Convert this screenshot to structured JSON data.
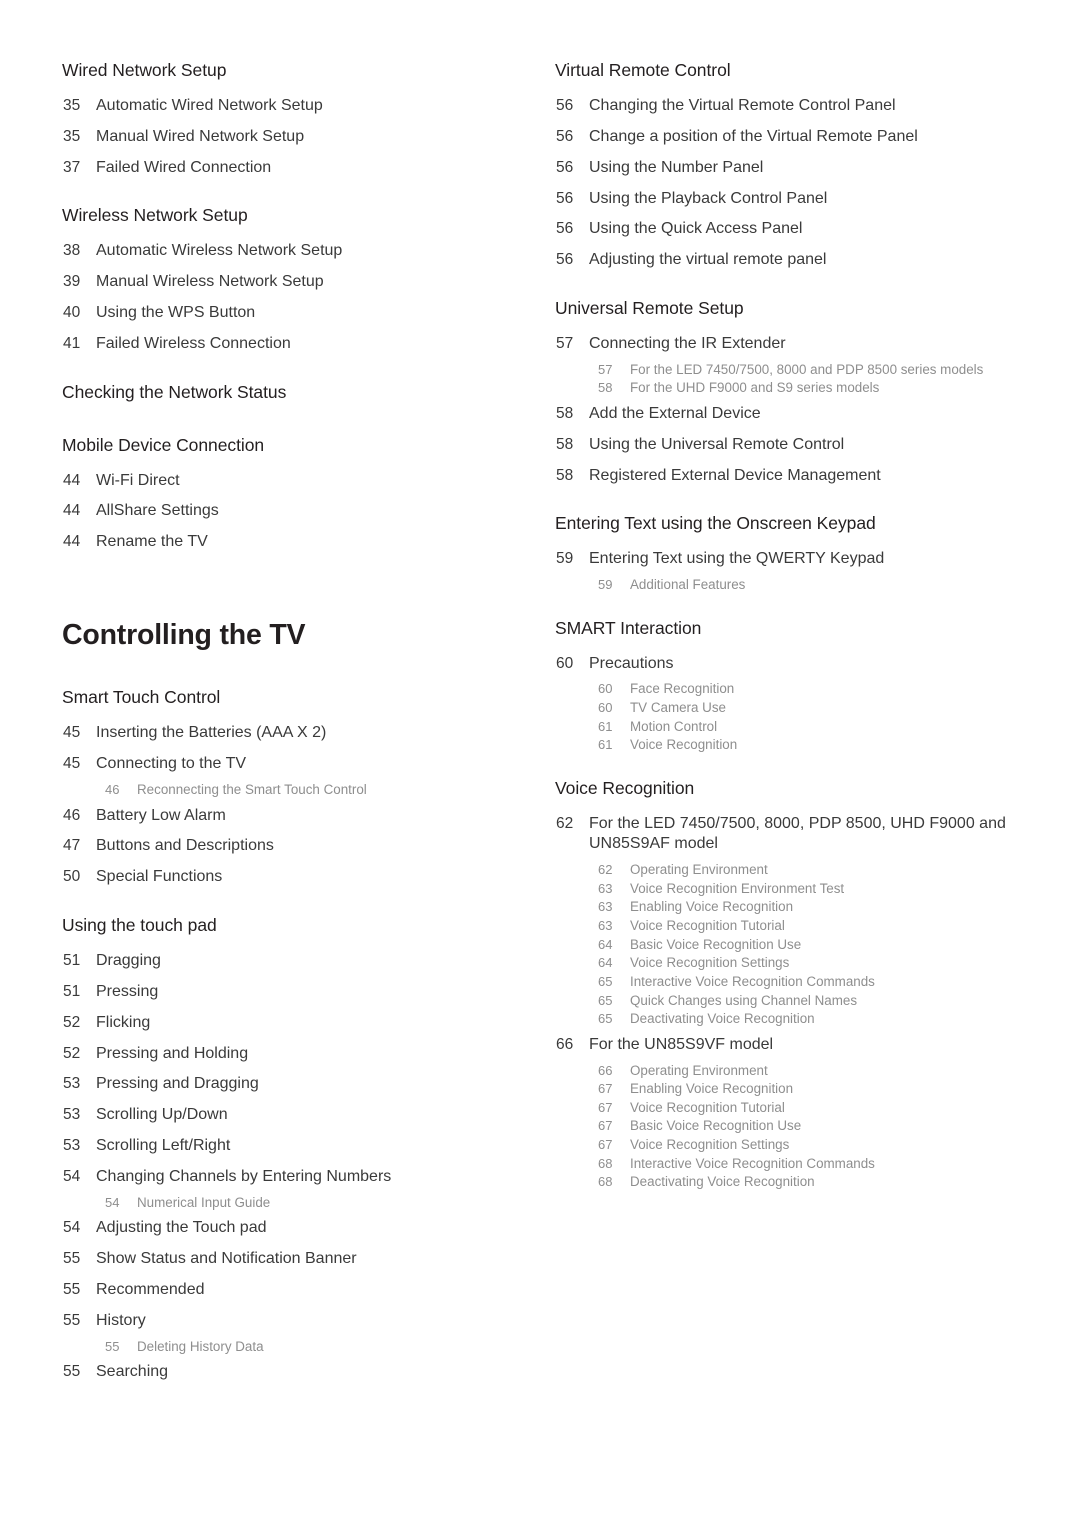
{
  "document": {
    "type": "table-of-contents",
    "background_color": "#ffffff",
    "text_color": "#3a3a3a",
    "sub_text_color": "#8e8e8e",
    "heading_color": "#231f20"
  },
  "left_column": [
    {
      "kind": "section",
      "heading": "Wired Network Setup",
      "entries": [
        {
          "level": 1,
          "page": "35",
          "title": "Automatic Wired Network Setup"
        },
        {
          "level": 1,
          "page": "35",
          "title": "Manual Wired Network Setup"
        },
        {
          "level": 1,
          "page": "37",
          "title": "Failed Wired Connection"
        }
      ]
    },
    {
      "kind": "section",
      "heading": "Wireless Network Setup",
      "entries": [
        {
          "level": 1,
          "page": "38",
          "title": "Automatic Wireless Network Setup"
        },
        {
          "level": 1,
          "page": "39",
          "title": "Manual Wireless Network Setup"
        },
        {
          "level": 1,
          "page": "40",
          "title": "Using the WPS Button"
        },
        {
          "level": 1,
          "page": "41",
          "title": "Failed Wireless Connection"
        }
      ]
    },
    {
      "kind": "section",
      "heading": "Checking the Network Status",
      "entries": []
    },
    {
      "kind": "section",
      "heading": "Mobile Device Connection",
      "entries": [
        {
          "level": 1,
          "page": "44",
          "title": "Wi-Fi Direct"
        },
        {
          "level": 1,
          "page": "44",
          "title": "AllShare Settings"
        },
        {
          "level": 1,
          "page": "44",
          "title": "Rename the TV"
        }
      ]
    },
    {
      "kind": "chapter",
      "heading": "Controlling the TV"
    },
    {
      "kind": "section",
      "heading": "Smart Touch Control",
      "entries": [
        {
          "level": 1,
          "page": "45",
          "title": "Inserting the Batteries (AAA X 2)"
        },
        {
          "level": 1,
          "page": "45",
          "title": "Connecting to the TV"
        },
        {
          "level": 2,
          "page": "46",
          "title": "Reconnecting the Smart Touch Control"
        },
        {
          "level": 1,
          "page": "46",
          "title": "Battery Low Alarm"
        },
        {
          "level": 1,
          "page": "47",
          "title": "Buttons and Descriptions"
        },
        {
          "level": 1,
          "page": "50",
          "title": "Special Functions"
        }
      ]
    },
    {
      "kind": "section",
      "heading": "Using the touch pad",
      "entries": [
        {
          "level": 1,
          "page": "51",
          "title": "Dragging"
        },
        {
          "level": 1,
          "page": "51",
          "title": "Pressing"
        },
        {
          "level": 1,
          "page": "52",
          "title": "Flicking"
        },
        {
          "level": 1,
          "page": "52",
          "title": "Pressing and Holding"
        },
        {
          "level": 1,
          "page": "53",
          "title": "Pressing and Dragging"
        },
        {
          "level": 1,
          "page": "53",
          "title": "Scrolling Up/Down"
        },
        {
          "level": 1,
          "page": "53",
          "title": "Scrolling Left/Right"
        },
        {
          "level": 1,
          "page": "54",
          "title": "Changing Channels by Entering Numbers"
        },
        {
          "level": 2,
          "page": "54",
          "title": "Numerical Input Guide"
        },
        {
          "level": 1,
          "page": "54",
          "title": "Adjusting the Touch pad"
        },
        {
          "level": 1,
          "page": "55",
          "title": "Show Status and Notification Banner"
        },
        {
          "level": 1,
          "page": "55",
          "title": "Recommended"
        },
        {
          "level": 1,
          "page": "55",
          "title": "History"
        },
        {
          "level": 2,
          "page": "55",
          "title": "Deleting History Data"
        },
        {
          "level": 1,
          "page": "55",
          "title": "Searching"
        }
      ]
    }
  ],
  "right_column": [
    {
      "kind": "section",
      "heading": "Virtual Remote Control",
      "entries": [
        {
          "level": 1,
          "page": "56",
          "title": "Changing the Virtual Remote Control Panel"
        },
        {
          "level": 1,
          "page": "56",
          "title": "Change a position of the Virtual Remote Panel"
        },
        {
          "level": 1,
          "page": "56",
          "title": "Using the Number Panel"
        },
        {
          "level": 1,
          "page": "56",
          "title": "Using the Playback Control Panel"
        },
        {
          "level": 1,
          "page": "56",
          "title": "Using the Quick Access Panel"
        },
        {
          "level": 1,
          "page": "56",
          "title": "Adjusting the virtual remote panel"
        }
      ]
    },
    {
      "kind": "section",
      "heading": "Universal Remote Setup",
      "entries": [
        {
          "level": 1,
          "page": "57",
          "title": "Connecting the IR Extender"
        },
        {
          "level": 2,
          "page": "57",
          "title": "For the LED 7450/7500, 8000 and PDP 8500 series models"
        },
        {
          "level": 2,
          "page": "58",
          "title": "For the UHD F9000 and S9 series models"
        },
        {
          "level": 1,
          "page": "58",
          "title": "Add the External Device"
        },
        {
          "level": 1,
          "page": "58",
          "title": "Using the Universal Remote Control"
        },
        {
          "level": 1,
          "page": "58",
          "title": "Registered External Device Management"
        }
      ]
    },
    {
      "kind": "section",
      "heading": "Entering Text using the Onscreen Keypad",
      "entries": [
        {
          "level": 1,
          "page": "59",
          "title": "Entering Text using the QWERTY Keypad"
        },
        {
          "level": 2,
          "page": "59",
          "title": "Additional Features"
        }
      ]
    },
    {
      "kind": "section",
      "heading": "SMART Interaction",
      "entries": [
        {
          "level": 1,
          "page": "60",
          "title": "Precautions"
        },
        {
          "level": 2,
          "page": "60",
          "title": "Face Recognition"
        },
        {
          "level": 2,
          "page": "60",
          "title": "TV Camera Use"
        },
        {
          "level": 2,
          "page": "61",
          "title": "Motion Control"
        },
        {
          "level": 2,
          "page": "61",
          "title": "Voice Recognition"
        }
      ]
    },
    {
      "kind": "section",
      "heading": "Voice Recognition",
      "entries": [
        {
          "level": 1,
          "page": "62",
          "title": "For the LED 7450/7500, 8000, PDP 8500, UHD F9000 and UN85S9AF model"
        },
        {
          "level": 2,
          "page": "62",
          "title": "Operating Environment"
        },
        {
          "level": 2,
          "page": "63",
          "title": "Voice Recognition Environment Test"
        },
        {
          "level": 2,
          "page": "63",
          "title": "Enabling Voice Recognition"
        },
        {
          "level": 2,
          "page": "63",
          "title": "Voice Recognition Tutorial"
        },
        {
          "level": 2,
          "page": "64",
          "title": "Basic Voice Recognition Use"
        },
        {
          "level": 2,
          "page": "64",
          "title": "Voice Recognition Settings"
        },
        {
          "level": 2,
          "page": "65",
          "title": "Interactive Voice Recognition Commands"
        },
        {
          "level": 2,
          "page": "65",
          "title": "Quick Changes using Channel Names"
        },
        {
          "level": 2,
          "page": "65",
          "title": "Deactivating Voice Recognition"
        },
        {
          "level": 1,
          "page": "66",
          "title": "For the UN85S9VF model"
        },
        {
          "level": 2,
          "page": "66",
          "title": "Operating Environment"
        },
        {
          "level": 2,
          "page": "67",
          "title": "Enabling Voice Recognition"
        },
        {
          "level": 2,
          "page": "67",
          "title": "Voice Recognition Tutorial"
        },
        {
          "level": 2,
          "page": "67",
          "title": "Basic Voice Recognition Use"
        },
        {
          "level": 2,
          "page": "67",
          "title": "Voice Recognition Settings"
        },
        {
          "level": 2,
          "page": "68",
          "title": "Interactive Voice Recognition Commands"
        },
        {
          "level": 2,
          "page": "68",
          "title": "Deactivating Voice Recognition"
        }
      ]
    }
  ]
}
